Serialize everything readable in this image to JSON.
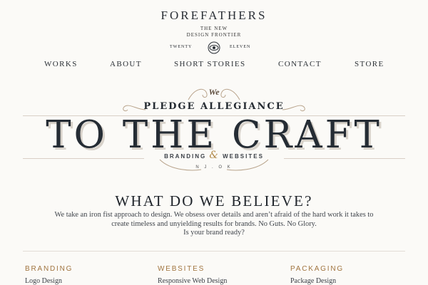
{
  "logo": {
    "name": "FOREFATHERS",
    "tagline_line1": "THE NEW",
    "tagline_line2": "DESIGN FRONTIER",
    "left_word": "TWENTY",
    "right_word": "ELEVEN",
    "emblem_icon": "eye-icon"
  },
  "nav": {
    "items": [
      {
        "label": "WORKS"
      },
      {
        "label": "ABOUT"
      },
      {
        "label": "SHORT STORIES"
      },
      {
        "label": "CONTACT"
      },
      {
        "label": "STORE"
      }
    ]
  },
  "hero": {
    "we": "We",
    "pledge": "PLEDGE ALLEGIANCE",
    "headline": "TO THE CRAFT",
    "branding": "BRANDING",
    "amp": "&",
    "websites": "WEBSITES",
    "location": "N J . O K"
  },
  "believe": {
    "title": "WHAT DO WE BELIEVE?",
    "line1": "We take an iron fist approach to design. We obsess over details and aren’t afraid of the hard work it takes to",
    "line2": "create timeless and unyielding results for brands. No Guts. No Glory.",
    "line3": "Is your brand ready?"
  },
  "services": [
    {
      "heading": "BRANDING",
      "item": "Logo Design"
    },
    {
      "heading": "WEBSITES",
      "item": "Responsive Web Design"
    },
    {
      "heading": "PACKAGING",
      "item": "Package Design"
    }
  ],
  "colors": {
    "background": "#fbfaf7",
    "ink": "#22262c",
    "accent_gold": "#a0743f",
    "shadow": "#d8d2ca"
  }
}
